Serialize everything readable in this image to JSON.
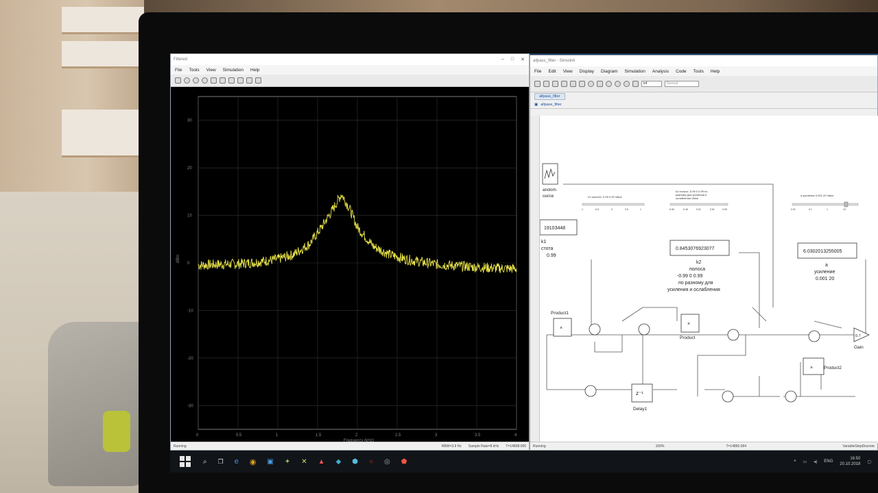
{
  "scope": {
    "title": "Filtered",
    "menu": [
      "File",
      "Tools",
      "View",
      "Simulation",
      "Help"
    ],
    "y_axis_label": "dBm",
    "x_axis_label": "Frequency (kHz)",
    "y_ticks": [
      "30",
      "20",
      "10",
      "0",
      "-10",
      "-20",
      "-30"
    ],
    "x_ticks": [
      "0",
      "0.5",
      "1",
      "1.5",
      "2",
      "2.5",
      "3",
      "3.5",
      "4"
    ],
    "status_left": "Running",
    "status_rbw": "RBW=3.9 Hz",
    "status_rate": "Sample Rate=8 kHz",
    "status_time": "T=14808.000"
  },
  "chart_data": {
    "type": "line",
    "title": "",
    "xlabel": "Frequency (kHz)",
    "ylabel": "dBm",
    "xlim": [
      0,
      4
    ],
    "ylim": [
      -35,
      35
    ],
    "grid": true,
    "series": [
      {
        "color": "#e8e34a",
        "x": [
          0,
          0.25,
          0.5,
          0.75,
          1.0,
          1.2,
          1.4,
          1.55,
          1.7,
          1.8,
          1.9,
          2.0,
          2.2,
          2.4,
          2.6,
          2.8,
          3.0,
          3.25,
          3.5,
          3.75,
          4.0
        ],
        "y": [
          -0.5,
          -0.3,
          -0.2,
          0.2,
          0.8,
          1.8,
          4.0,
          7.5,
          11.5,
          14.5,
          11.5,
          7.5,
          3.5,
          1.8,
          0.8,
          0.2,
          -0.3,
          -0.6,
          -0.9,
          -1.1,
          -1.2
        ]
      }
    ]
  },
  "simulink": {
    "title": "allpass_filter - Simulink",
    "menu": [
      "File",
      "Edit",
      "View",
      "Display",
      "Diagram",
      "Simulation",
      "Analysis",
      "Code",
      "Tools",
      "Help"
    ],
    "stop_time": "inf",
    "mode": "Normal",
    "tab_label": "allpass_filter",
    "breadcrumb": "allpass_filter",
    "blocks": {
      "random_source_label_1": "andom",
      "random_source_label_2": "ource",
      "slider1_title": "k1 частота -0.99 0.99 Value",
      "slider1_ticks": [
        "-1",
        "-0.5",
        "0",
        "0.5",
        "1"
      ],
      "slider2_title_1": "k2 полоса -0.99 0 0.99 по",
      "slider2_title_2": "разному для усиления и",
      "slider2_title_3": "ослабления Value",
      "slider2_ticks": [
        "-0.99",
        "-0.49",
        "0.01",
        "0.51",
        "0.99"
      ],
      "slider3_title": "a усиление 0.001 20 Value",
      "slider3_ticks": [
        "0.01",
        "0.1",
        "1",
        "10"
      ],
      "display1_value": "19103448",
      "k1_label_1": "k1",
      "k1_label_2": "стота",
      "k1_label_3": "0.99",
      "display2_value": "0.8453076923077",
      "k2_label_1": "k2",
      "k2_label_2": "полоса",
      "k2_label_3": "-0.99    0    0.99",
      "k2_label_4": "по разному для",
      "k2_label_5": "усиления и ослабления",
      "display3_value": "6.0302013255005",
      "a_label_1": "a",
      "a_label_2": "усиление",
      "a_label_3": "0.001    20",
      "product1": "Product1",
      "product": "Product",
      "product2": "Product2",
      "delay1": "Delay1",
      "gain": "Gain",
      "gain_value": "0.7",
      "delay_symbol": "z⁻¹"
    },
    "status_left": "Running",
    "status_zoom": "100%",
    "status_time": "T=14860.064",
    "status_solver": "VariableStepDiscrete"
  },
  "taskbar": {
    "lang": "ENG",
    "time": "16:50",
    "date": "20.10.2018"
  }
}
